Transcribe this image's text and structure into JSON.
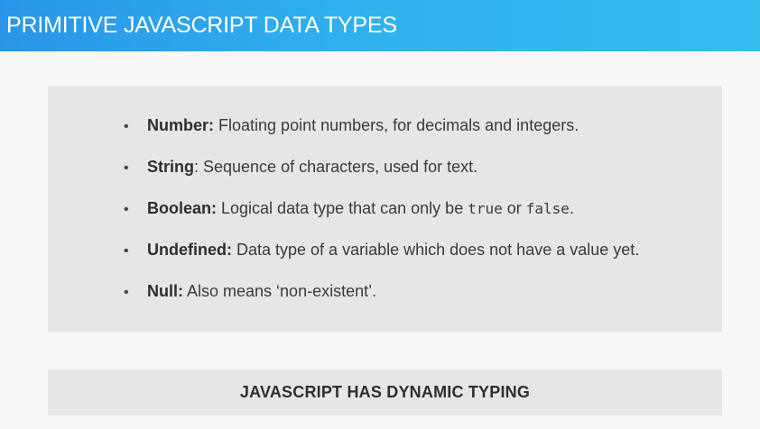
{
  "header": {
    "title": "PRIMITIVE JAVASCRIPT DATA TYPES"
  },
  "list": {
    "bullet": "•",
    "items": [
      {
        "term": "Number:",
        "text": " Floating point numbers, for decimals and integers."
      },
      {
        "term": "String",
        "text": ": Sequence of characters, used for text."
      },
      {
        "term": "Boolean:",
        "text": " Logical data type that can only be ",
        "code1": "true",
        "mid": " or ",
        "code2": "false",
        "end": "."
      },
      {
        "term": "Undefined:",
        "text": " Data type of a variable which does not have a value yet."
      },
      {
        "term": "Null:",
        "text": " Also means ‘non-existent’."
      }
    ]
  },
  "footer": {
    "text": "JAVASCRIPT HAS DYNAMIC TYPING"
  },
  "colors": {
    "header_gradient_start": "#2a95e8",
    "header_gradient_end": "#35bdf0",
    "panel": "#e6e6e9",
    "background": "#f7f7f8"
  }
}
